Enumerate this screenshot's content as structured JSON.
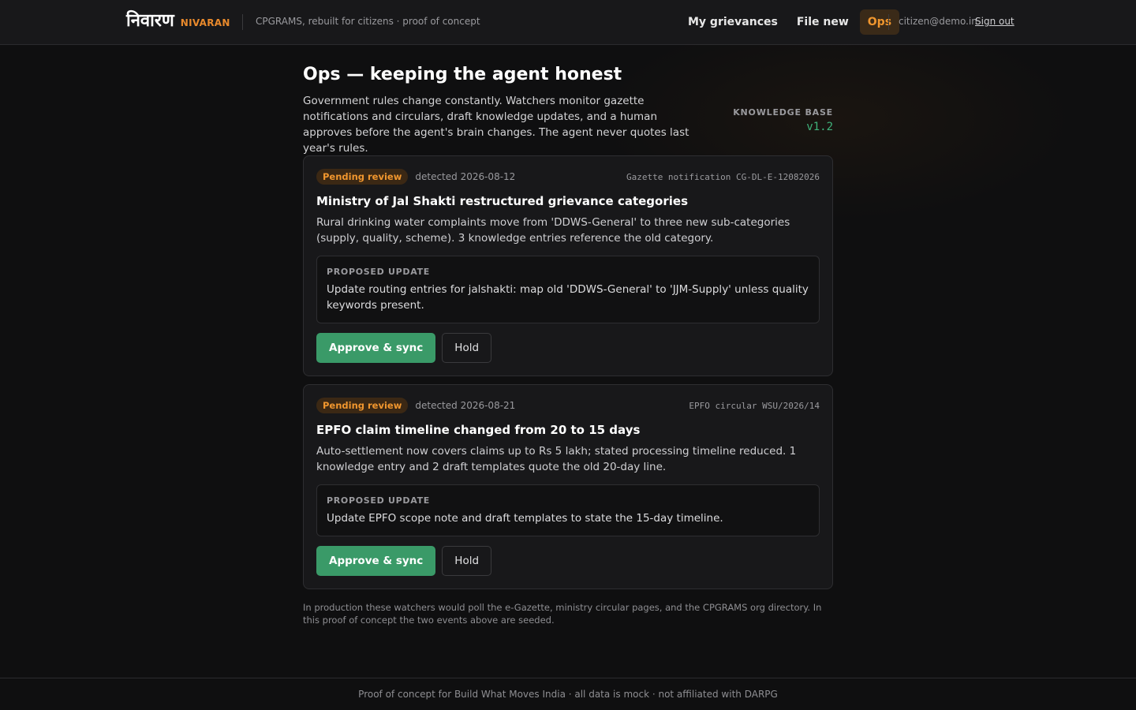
{
  "header": {
    "brand_devanagari": "निवारण",
    "brand_latin": "NIVARAN",
    "tagline": "CPGRAMS, rebuilt for citizens · proof of concept",
    "nav": [
      {
        "label": "My grievances"
      },
      {
        "label": "File new"
      },
      {
        "label": "Ops",
        "active": true
      }
    ],
    "user_email": "citizen@demo.in",
    "signout_label": "Sign out"
  },
  "page": {
    "title": "Ops — keeping the agent honest",
    "intro": "Government rules change constantly. Watchers monitor gazette notifications and circulars, draft knowledge updates, and a human approves before the agent's brain changes. The agent never quotes last year's rules.",
    "knowledge_base_label": "KNOWLEDGE BASE",
    "knowledge_base_version": "v1.2"
  },
  "events": [
    {
      "status": "Pending review",
      "detected": "detected 2026-08-12",
      "source": "Gazette notification CG-DL-E-12082026",
      "title": "Ministry of Jal Shakti restructured grievance categories",
      "description": "Rural drinking water complaints move from 'DDWS-General' to three new sub-categories (supply, quality, scheme). 3 knowledge entries reference the old category.",
      "proposal_label": "PROPOSED UPDATE",
      "proposal": "Update routing entries for jalshakti: map old 'DDWS-General' to 'JJM-Supply' unless quality keywords present.",
      "approve_label": "Approve & sync",
      "hold_label": "Hold"
    },
    {
      "status": "Pending review",
      "detected": "detected 2026-08-21",
      "source": "EPFO circular WSU/2026/14",
      "title": "EPFO claim timeline changed from 20 to 15 days",
      "description": "Auto-settlement now covers claims up to Rs 5 lakh; stated processing timeline reduced. 1 knowledge entry and 2 draft templates quote the old 20-day line.",
      "proposal_label": "PROPOSED UPDATE",
      "proposal": "Update EPFO scope note and draft templates to state the 15-day timeline.",
      "approve_label": "Approve & sync",
      "hold_label": "Hold"
    }
  ],
  "footnote": "In production these watchers would poll the e-Gazette, ministry circular pages, and the CPGRAMS org directory. In this proof of concept the two events above are seeded.",
  "footer": "Proof of concept for Build What Moves India · all data is mock · not affiliated with DARPG",
  "colors": {
    "accent": "#f0962e",
    "approve": "#3a9a68",
    "version": "#3fb27a",
    "background": "#0f0f10"
  }
}
